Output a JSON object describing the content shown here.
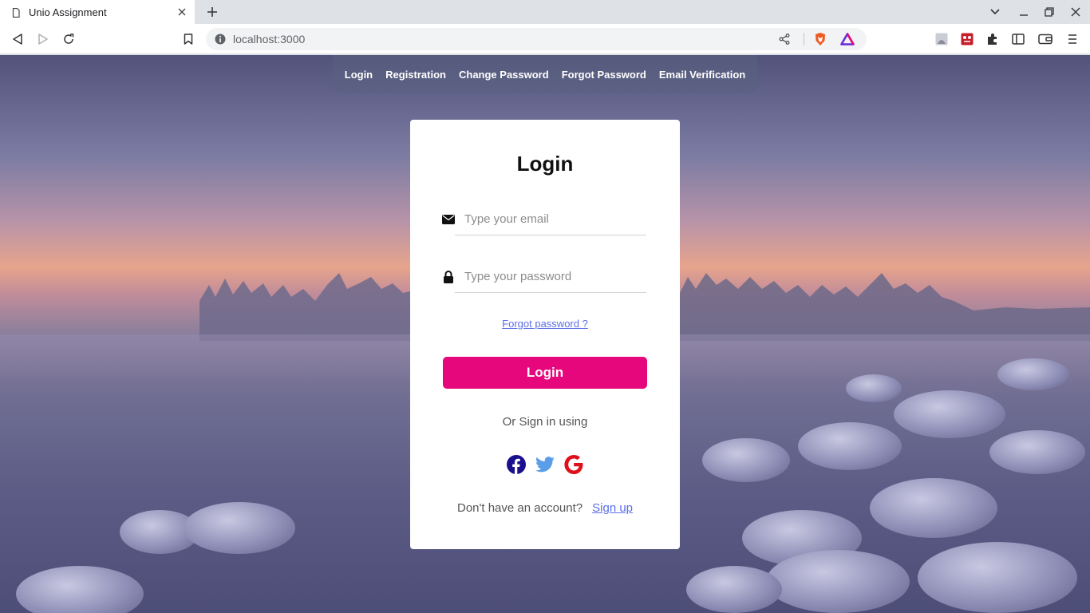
{
  "browser": {
    "tab_title": "Unio Assignment",
    "url": "localhost:3000"
  },
  "nav": {
    "items": [
      {
        "label": "Login"
      },
      {
        "label": "Registration"
      },
      {
        "label": "Change Password"
      },
      {
        "label": "Forgot Password"
      },
      {
        "label": "Email Verification"
      }
    ]
  },
  "login": {
    "title": "Login",
    "email_placeholder": "Type your email",
    "password_placeholder": "Type your password",
    "forgot_label": "Forgot password ?",
    "submit_label": "Login",
    "or_label": "Or Sign in using",
    "no_account_label": "Don't have an account?",
    "signup_label": "Sign up"
  },
  "social_icons": [
    "facebook-icon",
    "twitter-icon",
    "google-icon"
  ],
  "colors": {
    "accent": "#e6077c",
    "link": "#5b6ee8",
    "facebook": "#1a0f8f",
    "twitter": "#5a9de8",
    "google": "#e0101a"
  }
}
